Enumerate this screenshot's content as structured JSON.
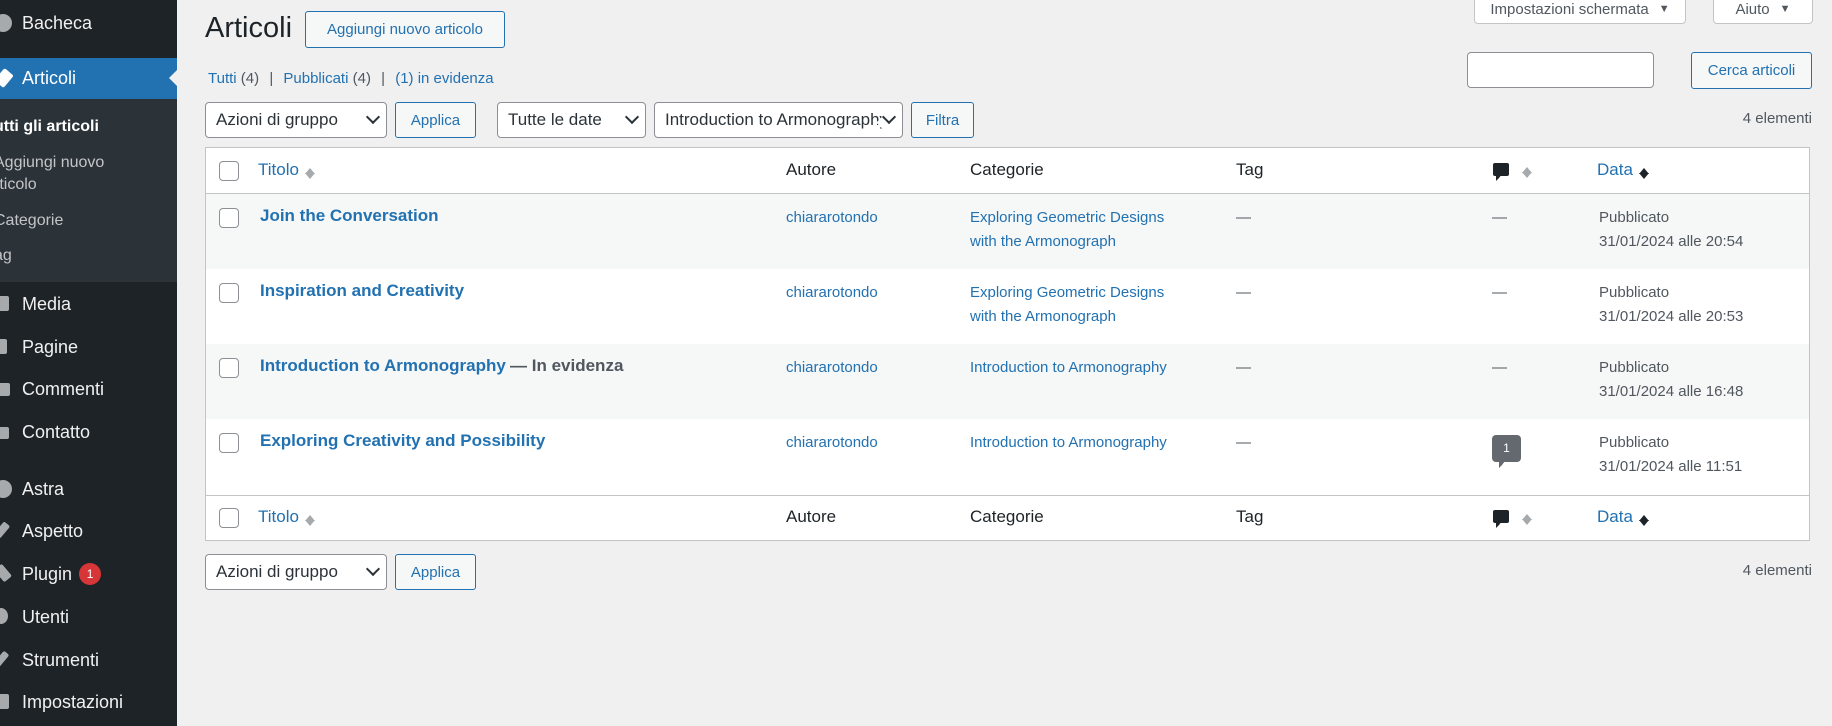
{
  "sidebar": {
    "items": [
      {
        "label": "Bacheca",
        "icon": "dashboard-icon"
      },
      {
        "label": "Articoli",
        "icon": "pin-icon"
      },
      {
        "label": "Media",
        "icon": "media-icon"
      },
      {
        "label": "Pagine",
        "icon": "page-icon"
      },
      {
        "label": "Commenti",
        "icon": "comment-icon"
      },
      {
        "label": "Contatto",
        "icon": "mail-icon"
      },
      {
        "label": "Astra",
        "icon": "astra-icon"
      },
      {
        "label": "Aspetto",
        "icon": "brush-icon"
      },
      {
        "label": "Plugin",
        "icon": "plugin-icon",
        "badge": "1"
      },
      {
        "label": "Utenti",
        "icon": "users-icon"
      },
      {
        "label": "Strumenti",
        "icon": "wrench-icon"
      },
      {
        "label": "Impostazioni",
        "icon": "settings-icon"
      }
    ],
    "submenu": [
      "utti gli articoli",
      "Aggiungi nuovo",
      "rticolo",
      "Categorie",
      "ag"
    ]
  },
  "header": {
    "title": "Articoli",
    "add_new": "Aggiungi nuovo articolo",
    "screen_options": "Impostazioni schermata",
    "help": "Aiuto"
  },
  "views": {
    "all": "Tutti",
    "all_count": "(4)",
    "published": "Pubblicati",
    "published_count": "(4)",
    "sticky": "(1) in evidenza",
    "sep": "|"
  },
  "search": {
    "button": "Cerca articoli",
    "value": ""
  },
  "filters": {
    "bulk": "Azioni di gruppo",
    "apply": "Applica",
    "dates": "Tutte le date",
    "category": "Introduction to Armonography",
    "filter": "Filtra",
    "count": "4 elementi"
  },
  "table": {
    "columns": {
      "title": "Titolo",
      "author": "Autore",
      "categories": "Categorie",
      "tags": "Tag",
      "date": "Data"
    },
    "rows": [
      {
        "title": "Join the Conversation",
        "state": "",
        "author": "chiararotondo",
        "category_1": "Exploring Geometric Designs",
        "category_2": "with the Armonograph",
        "tags": "—",
        "comments": "—",
        "status": "Pubblicato",
        "date": "31/01/2024 alle 20:54"
      },
      {
        "title": "Inspiration and Creativity",
        "state": "",
        "author": "chiararotondo",
        "category_1": "Exploring Geometric Designs",
        "category_2": "with the Armonograph",
        "tags": "—",
        "comments": "—",
        "status": "Pubblicato",
        "date": "31/01/2024 alle 20:53"
      },
      {
        "title": "Introduction to Armonography",
        "state": "— In evidenza",
        "author": "chiararotondo",
        "category_1": "Introduction to Armonography",
        "category_2": "",
        "tags": "—",
        "comments": "—",
        "status": "Pubblicato",
        "date": "31/01/2024 alle 16:48"
      },
      {
        "title": "Exploring Creativity and Possibility",
        "state": "",
        "author": "chiararotondo",
        "category_1": "Introduction to Armonography",
        "category_2": "",
        "tags": "—",
        "comments": "1",
        "status": "Pubblicato",
        "date": "31/01/2024 alle 11:51"
      }
    ]
  },
  "colors": {
    "sidebar_bg": "#1d2327",
    "accent": "#2271b1",
    "badge": "#d63638"
  }
}
